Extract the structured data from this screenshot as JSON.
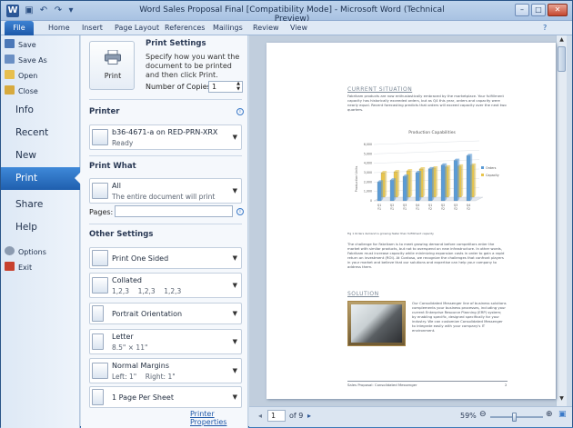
{
  "window": {
    "title": "Word Sales Proposal Final [Compatibility Mode] - Microsoft Word (Technical Preview)"
  },
  "ribbon": {
    "tabs": [
      "File",
      "Home",
      "Insert",
      "Page Layout",
      "References",
      "Mailings",
      "Review",
      "View"
    ]
  },
  "nav": {
    "small_items": [
      "Save",
      "Save As",
      "Open",
      "Close"
    ],
    "big_items": [
      "Info",
      "Recent",
      "New",
      "Print",
      "Share",
      "Help"
    ],
    "bottom_items": [
      "Options",
      "Exit"
    ]
  },
  "print_panel": {
    "print_label": "Print",
    "settings_heading": "Print Settings",
    "settings_desc": "Specify how you want the document to be printed and then click Print.",
    "copies_label": "Number of Copies:",
    "copies_value": "1",
    "printer_heading": "Printer",
    "printer_name": "b36-4671-a on RED-PRN-XRX",
    "printer_status": "Ready",
    "print_what_heading": "Print What",
    "print_what_value": "All",
    "print_what_desc": "The entire document will print",
    "pages_label": "Pages:",
    "other_heading": "Other Settings",
    "sides": "Print One Sided",
    "collate": "Collated",
    "collate_desc": "1,2,3    1,2,3    1,2,3",
    "orientation": "Portrait Orientation",
    "paper": "Letter",
    "paper_size": "8.5\" × 11\"",
    "margins": "Normal Margins",
    "margins_desc": "Left: 1\"    Right: 1\"",
    "per_sheet": "1 Page Per Sheet",
    "printer_properties": "Printer Properties"
  },
  "preview": {
    "heading1": "CURRENT SITUATION",
    "para1": "Fabrikam products are now enthusiastically embraced by the marketplace. Your fulfillment capacity has historically exceeded orders, but as Q4 this year, orders and capacity were nearly equal. Recent forecasting predicts that orders will exceed capacity over the next two quarters.",
    "caption": "Fig 1 Orders demand is growing faster than fulfillment capacity",
    "para2": "The challenge for Fabrikam is to meet growing demand before competitors enter the market with similar products, but not to overspend on new infrastructure. In other words, Fabrikam must increase capacity while minimizing expansion costs in order to gain a rapid return on investment (ROI). At Contoso, we recognize the challenges that confront players in your market and believe that our solutions and expertise can help your company to address them.",
    "heading2": "SOLUTION",
    "para3": "Our Consolidated Messenger line of business solutions complements your business processes, including your current Enterprise Resource Planning (ERP) system; by enabling specific, designed specifically for your industry. We can customize Consolidated Messenger to integrate easily with your company's IT environment.",
    "footer_left": "Sales Proposal: Consolidated Messenger",
    "footer_right": "2"
  },
  "chart_data": {
    "type": "bar",
    "title": "Production Capabilities",
    "ylabel": "Production Units",
    "categories": [
      "Q1 Y1",
      "Q2 Y1",
      "Q3 Y1",
      "Q4 Y1",
      "Q1 Y2",
      "Q2 Y2",
      "Q3 Y2",
      "Q4 Y2"
    ],
    "series": [
      {
        "name": "Orders",
        "values": [
          2000,
          2200,
          2600,
          3000,
          3400,
          3800,
          4300,
          4800
        ]
      },
      {
        "name": "Capacity",
        "values": [
          2600,
          2700,
          2800,
          3000,
          3100,
          3200,
          3300,
          3400
        ]
      }
    ],
    "ylim": [
      0,
      6000
    ],
    "yticks": [
      "6,000",
      "5,000",
      "4,000",
      "3,000",
      "2,000",
      "1,000",
      "0"
    ],
    "colors": {
      "Orders": "#5b9bd5",
      "Capacity": "#e8c44a"
    },
    "legend": "right"
  },
  "status": {
    "page": "1",
    "of_pages": "of 9",
    "zoom": "59%"
  }
}
